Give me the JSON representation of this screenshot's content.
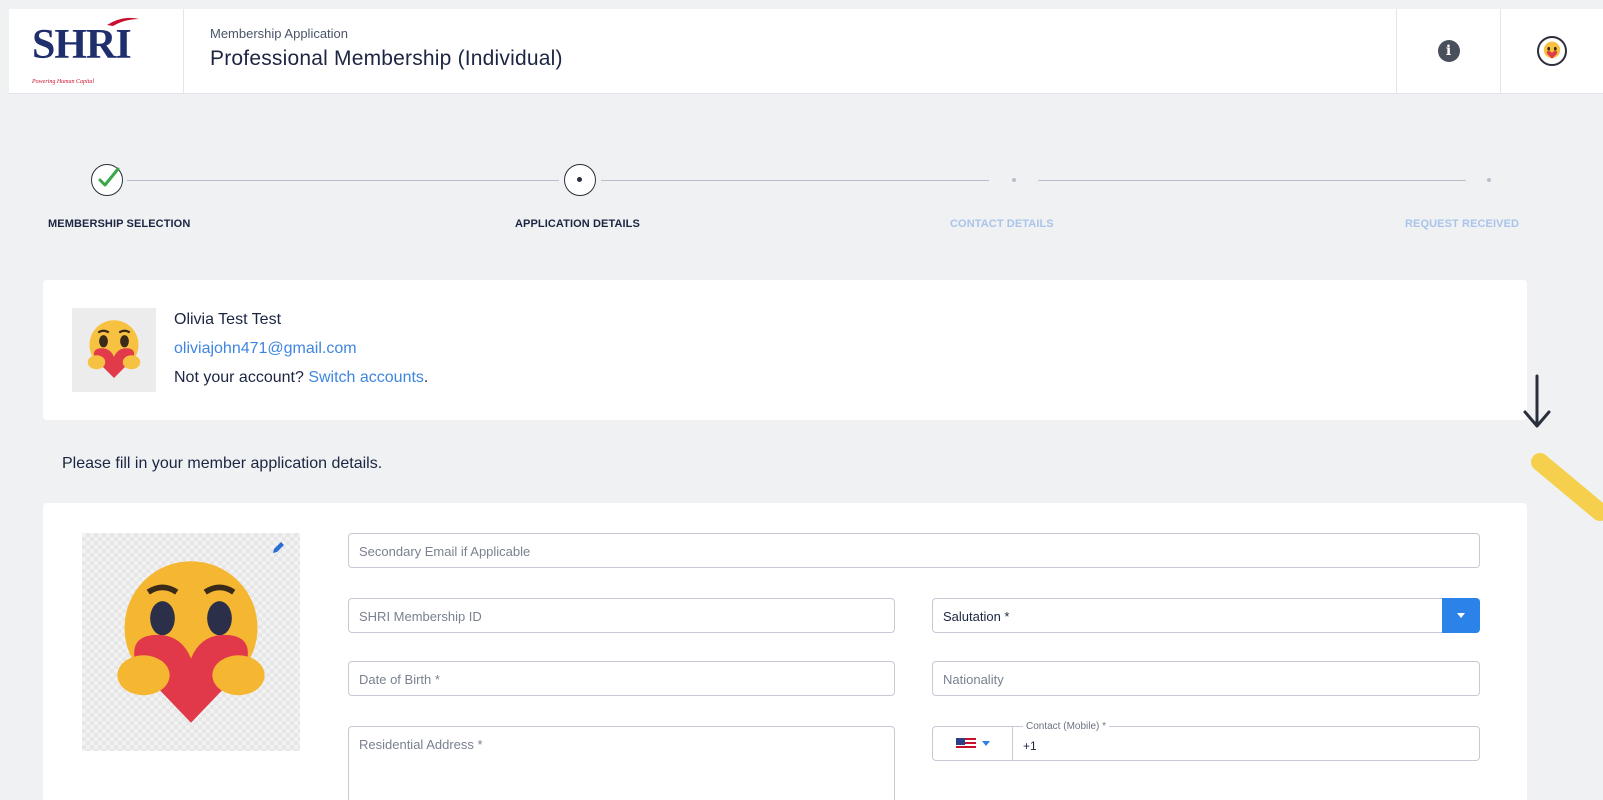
{
  "header": {
    "logo_text": "SHRI",
    "logo_tagline": "Powering Human Capital",
    "subtitle": "Membership Application",
    "title": "Professional Membership (Individual)",
    "info_icon": "info-icon",
    "avatar_icon": "care-emoji-avatar"
  },
  "stepper": {
    "steps": [
      {
        "label": "MEMBERSHIP SELECTION",
        "state": "done"
      },
      {
        "label": "APPLICATION DETAILS",
        "state": "current"
      },
      {
        "label": "CONTACT DETAILS",
        "state": "pending"
      },
      {
        "label": "REQUEST RECEIVED",
        "state": "pending"
      }
    ]
  },
  "account": {
    "name": "Olivia Test Test",
    "email": "oliviajohn471@gmail.com",
    "not_your_account": "Not your account?",
    "switch_link": "Switch accounts",
    "period": "."
  },
  "instruction": "Please fill in your member application details.",
  "form": {
    "secondary_email_placeholder": "Secondary Email if Applicable",
    "membership_id_placeholder": "SHRI Membership ID",
    "salutation_placeholder": "Salutation *",
    "dob_placeholder": "Date of Birth *",
    "nationality_placeholder": "Nationality",
    "address_placeholder": "Residential Address *",
    "contact_label": "Contact (Mobile) *",
    "contact_value": "+1",
    "country_flag": "us-flag-icon"
  },
  "colors": {
    "brand_navy": "#1f2f6e",
    "link_blue": "#3f86e0",
    "select_blue": "#2b82e8",
    "inactive_step": "#a9c4ea"
  }
}
